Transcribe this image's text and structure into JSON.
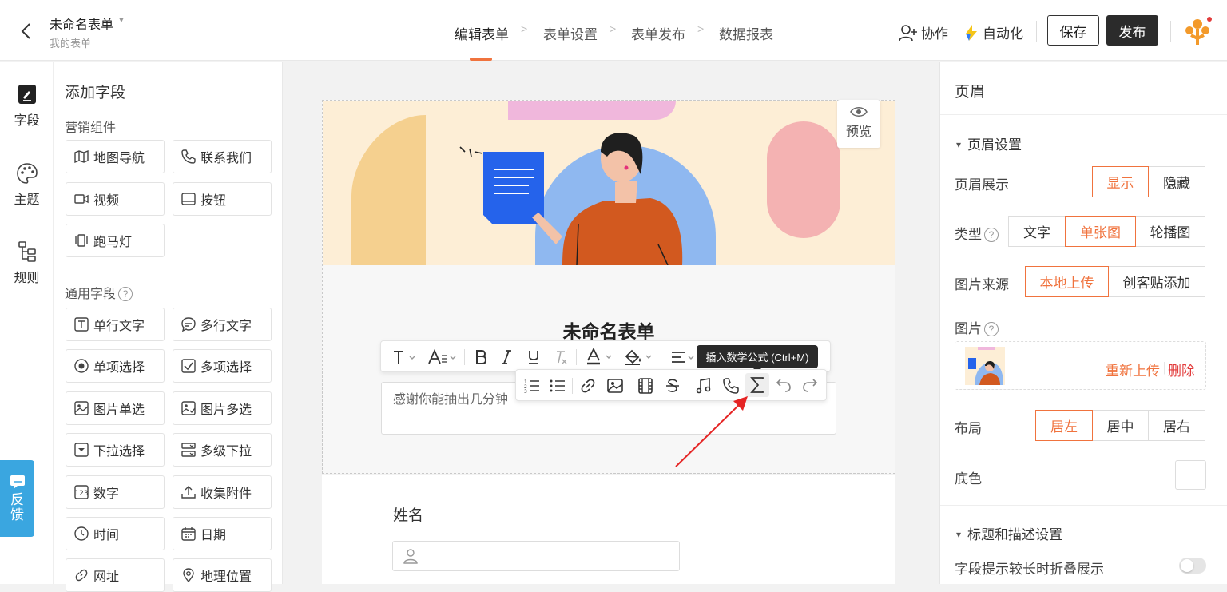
{
  "header": {
    "form_title": "未命名表单",
    "form_subtitle": "我的表单",
    "steps": [
      "编辑表单",
      "表单设置",
      "表单发布",
      "数据报表"
    ],
    "collab_label": "协作",
    "automation_label": "自动化",
    "save_label": "保存",
    "publish_label": "发布"
  },
  "rail": {
    "items": [
      {
        "label": "字段",
        "icon": "edit-document-icon"
      },
      {
        "label": "主题",
        "icon": "palette-icon"
      },
      {
        "label": "规则",
        "icon": "flow-rules-icon"
      }
    ],
    "feedback_label": "反馈"
  },
  "fields_panel": {
    "title": "添加字段",
    "marketing_title": "营销组件",
    "marketing": [
      {
        "label": "地图导航",
        "icon": "map-icon"
      },
      {
        "label": "联系我们",
        "icon": "phone-icon"
      },
      {
        "label": "视频",
        "icon": "video-icon"
      },
      {
        "label": "按钮",
        "icon": "button-icon"
      },
      {
        "label": "跑马灯",
        "icon": "carousel-icon"
      }
    ],
    "general_title": "通用字段",
    "general": [
      {
        "label": "单行文字",
        "icon": "text-field-icon"
      },
      {
        "label": "多行文字",
        "icon": "multiline-icon"
      },
      {
        "label": "单项选择",
        "icon": "radio-icon"
      },
      {
        "label": "多项选择",
        "icon": "checkbox-icon"
      },
      {
        "label": "图片单选",
        "icon": "image-radio-icon"
      },
      {
        "label": "图片多选",
        "icon": "image-check-icon"
      },
      {
        "label": "下拉选择",
        "icon": "dropdown-icon"
      },
      {
        "label": "多级下拉",
        "icon": "cascade-icon"
      },
      {
        "label": "数字",
        "icon": "number-icon"
      },
      {
        "label": "收集附件",
        "icon": "upload-icon"
      },
      {
        "label": "时间",
        "icon": "clock-icon"
      },
      {
        "label": "日期",
        "icon": "calendar-icon"
      },
      {
        "label": "网址",
        "icon": "link-icon"
      },
      {
        "label": "地理位置",
        "icon": "location-icon"
      }
    ]
  },
  "canvas": {
    "preview_label": "预览",
    "form_title": "未命名表单",
    "description": "感谢你能抽出几分钟",
    "tooltip": "插入数学公式 (Ctrl+M)",
    "question_label": "姓名",
    "accent_color": "#f0733e"
  },
  "right_panel": {
    "title": "页眉",
    "section_header": "页眉设置",
    "show_label": "页眉展示",
    "show_options": [
      "显示",
      "隐藏"
    ],
    "type_label": "类型",
    "type_options": [
      "文字",
      "单张图",
      "轮播图"
    ],
    "source_label": "图片来源",
    "source_options": [
      "本地上传",
      "创客贴添加"
    ],
    "image_label": "图片",
    "reupload_label": "重新上传",
    "separator": "|",
    "delete_label": "删除",
    "layout_label": "布局",
    "layout_options": [
      "居左",
      "居中",
      "居右"
    ],
    "bgcolor_label": "底色",
    "section2_header": "标题和描述设置",
    "collapse_label": "字段提示较长时折叠展示"
  }
}
